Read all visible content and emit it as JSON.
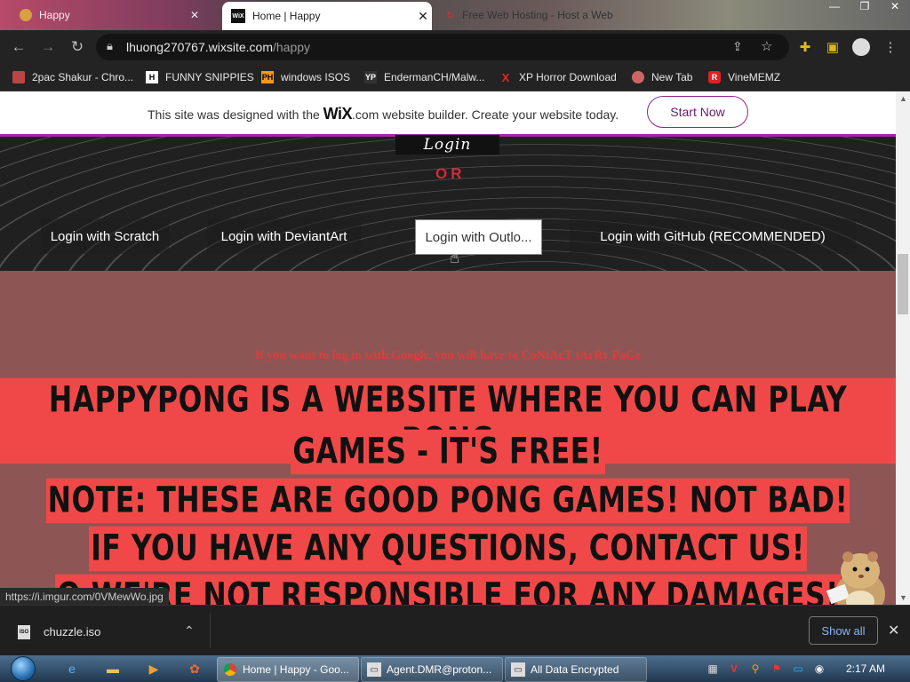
{
  "tabs": [
    {
      "label": "Happy"
    },
    {
      "label": "Home | Happy",
      "favicon": "WiX"
    },
    {
      "label": "Free Web Hosting - Host a Web"
    }
  ],
  "omnibox": {
    "domain": "lhuong270767.wixsite.com",
    "path": "/happy"
  },
  "bookmarks": [
    {
      "label": "2pac Shakur - Chro..."
    },
    {
      "label": "FUNNY SNIPPIES",
      "icon": "H"
    },
    {
      "label": "windows ISOS",
      "icon": "PH"
    },
    {
      "label": "EndermanCH/Malw...",
      "icon": "YP"
    },
    {
      "label": "XP Horror Download",
      "icon": "X"
    },
    {
      "label": "New Tab"
    },
    {
      "label": "VineMEMZ",
      "icon": "R"
    }
  ],
  "wix": {
    "pre": "This site was designed with the ",
    "logo": "WiX",
    "post": ".com website builder. Create your website today.",
    "button": "Start Now"
  },
  "hero": {
    "login": "Login",
    "or": "OR",
    "buttons": [
      "Login with Scratch",
      "Login with DeviantArt",
      "Login with Outlo...",
      "Login with GitHub (RECOMMENDED)"
    ]
  },
  "main": {
    "notice": "If you want to log in with Google, you will have to CoNtAcT tArRy PaGe",
    "lines": [
      "HAPPYPONG IS A WEBSITE WHERE YOU CAN PLAY PONG",
      "GAMES - IT'S FREE!",
      "NOTE: THESE ARE GOOD PONG GAMES! NOT BAD!",
      "IF YOU HAVE ANY QUESTIONS, CONTACT US!",
      "O WE'RE NOT RESPONSIBLE FOR ANY DAMAGES!"
    ]
  },
  "status_url": "https://i.imgur.com/0VMewWo.jpg",
  "downloads": {
    "file": "chuzzle.iso",
    "show_all": "Show all"
  },
  "taskbar": {
    "tasks": [
      "Home | Happy - Goo...",
      "Agent.DMR@proton...",
      "All Data Encrypted"
    ],
    "clock": "2:17 AM"
  },
  "colors": {
    "accent_red": "#f04848",
    "wix_purple": "#9b2a9b",
    "page_bg": "#8e5555"
  }
}
